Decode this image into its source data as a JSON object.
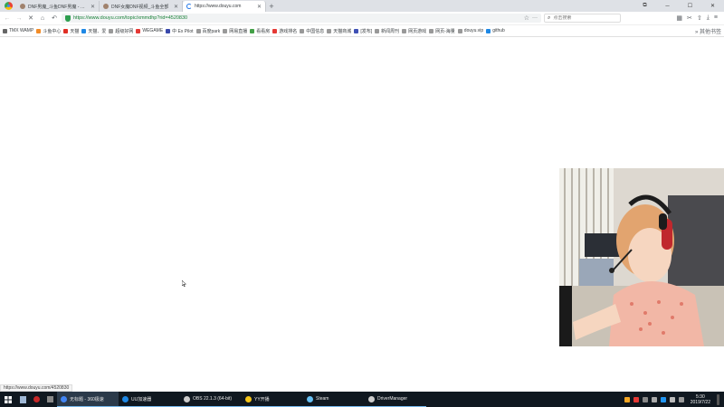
{
  "tabs": [
    {
      "label": "DNF男魔_斗鱼DNF男魔 - 斗鱼",
      "active": false
    },
    {
      "label": "DNF女魔DNF视频_斗鱼全部",
      "active": false
    },
    {
      "label": "https://www.douyu.com",
      "active": true
    }
  ],
  "window_controls": {
    "minimize": "─",
    "maximize": "☐",
    "close": "✕",
    "extra": "⧉"
  },
  "address_bar": {
    "url": "https://www.douyu.com/topic/xmmdhp?rid=4520830",
    "search_placeholder": "点击搜索"
  },
  "bookmarks": [
    {
      "label": "TMX WAMP",
      "color": "#666666"
    },
    {
      "label": "斗鱼中心",
      "color": "#f28c28"
    },
    {
      "label": "天猫",
      "color": "#e02e24"
    },
    {
      "label": "天猫、爱",
      "color": "#1e88e5"
    },
    {
      "label": "超级好网",
      "color": "#999999"
    },
    {
      "label": "WEGAME",
      "color": "#e53935"
    },
    {
      "label": "中 Ex Pilot",
      "color": "#3949ab"
    },
    {
      "label": "百度park",
      "color": "#999999"
    },
    {
      "label": "网易直播",
      "color": "#999999"
    },
    {
      "label": "看看房",
      "color": "#43a047"
    },
    {
      "label": "游戏排名",
      "color": "#e53935"
    },
    {
      "label": "中国信息",
      "color": "#999999"
    },
    {
      "label": "天猫商城",
      "color": "#999999"
    },
    {
      "label": "[发布]",
      "color": "#3f51b5"
    },
    {
      "label": "新闻周刊",
      "color": "#999999"
    },
    {
      "label": "网页游戏",
      "color": "#999999"
    },
    {
      "label": "网页-海量",
      "color": "#999999"
    },
    {
      "label": "douyu.vip",
      "color": "#999999"
    },
    {
      "label": "github",
      "color": "#1e88e5"
    }
  ],
  "bookmarks_more": "» 其他书签",
  "status_url": "https://www.douyu.com/4520830",
  "taskbar": {
    "apps": [
      {
        "label": "无标题 - 360极速",
        "color": "#4285f4",
        "active": true
      },
      {
        "label": "UU加速器",
        "color": "#1e88e5",
        "active": false
      },
      {
        "label": "OBS 22.1.3 (64-bit)",
        "color": "#cccccc",
        "active": false
      },
      {
        "label": "YY开播",
        "color": "#f5c518",
        "active": false
      },
      {
        "label": "Steam",
        "color": "#66c0f4",
        "active": false
      },
      {
        "label": "DriverManager",
        "color": "#cccccc",
        "active": false
      }
    ],
    "time": "5:30",
    "date": "2019/7/22"
  }
}
